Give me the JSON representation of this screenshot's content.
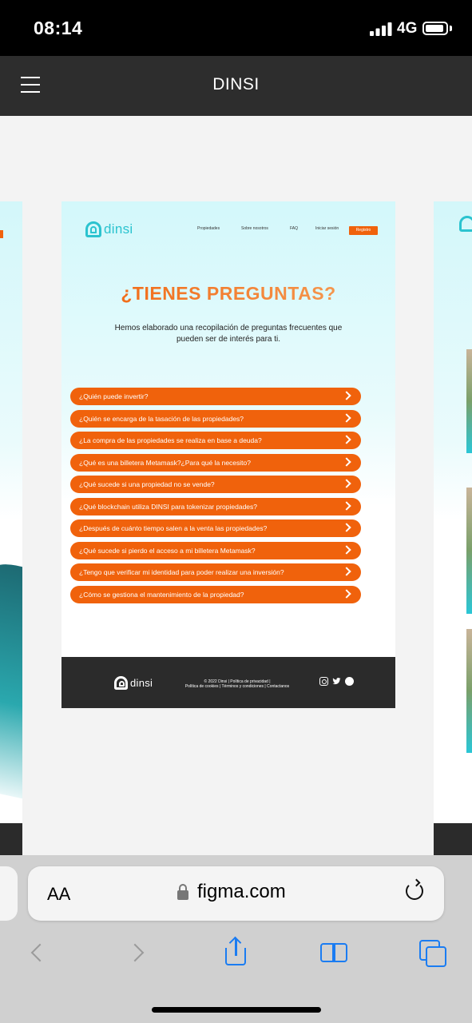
{
  "status_bar": {
    "time": "08:14",
    "network": "4G"
  },
  "figma_header": {
    "title": "DINSI"
  },
  "site": {
    "logo": "dinsi",
    "nav": [
      "Propiedades",
      "Sobre nosotros",
      "FAQ",
      "Iniciar sesión"
    ],
    "nav_button": "Registro",
    "title": "¿TIENES PREGUNTAS?",
    "subtitle": "Hemos elaborado una recopilación de preguntas frecuentes que pueden ser de interés para ti.",
    "faq": [
      "¿Quién puede invertir?",
      "¿Quién se encarga de la tasación de las propiedades?",
      "¿La compra de las propiedades se realiza en base a deuda?",
      "¿Qué es una billetera Metamask?¿Para qué la necesito?",
      "¿Qué sucede si una propiedad no se vende?",
      "¿Qué blockchain utiliza DINSI para tokenizar propiedades?",
      "¿Después de cuánto tiempo salen a la venta las propiedades?",
      "¿Qué sucede si pierdo el acceso a mi billetera Metamask?",
      "¿Tengo que verificar mi identidad para poder realizar una inversión?",
      "¿Cómo se gestiona el mantenimiento de la propiedad?"
    ],
    "footer": {
      "logo": "dinsi",
      "line1": "© 2022 Dinsi | Política de privacidad |",
      "line2": "Política de cookies | Términos y condiciones  |  Contactanos",
      "icons": [
        "instagram-icon",
        "twitter-icon",
        "github-icon"
      ]
    }
  },
  "safari": {
    "text_size": "AA",
    "domain": "figma.com"
  },
  "colors": {
    "accent": "#f0620c",
    "brand_teal": "#2bc3cf",
    "footer_bg": "#2b2b2b",
    "safari_blue": "#1a7cf2"
  }
}
